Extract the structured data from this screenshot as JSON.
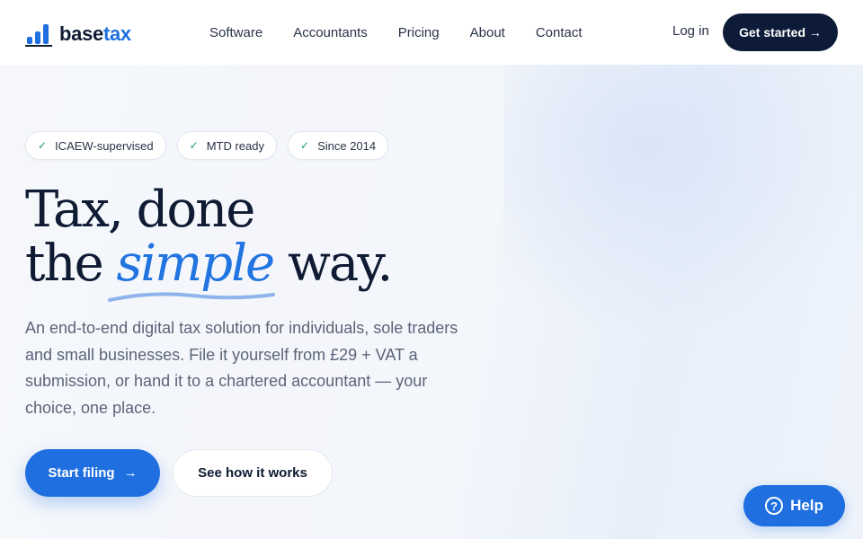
{
  "brand": {
    "name_part1": "base",
    "name_part2": "tax",
    "accent": "#1f6fe0",
    "dark": "#0d1b38"
  },
  "nav": {
    "items": [
      "Software",
      "Accountants",
      "Pricing",
      "About",
      "Contact"
    ]
  },
  "header": {
    "login": "Log in",
    "cta": "Get started →"
  },
  "badges": [
    {
      "icon": "check-icon",
      "label": "ICAEW-supervised"
    },
    {
      "icon": "check-icon",
      "label": "MTD ready"
    },
    {
      "icon": "check-icon",
      "label": "Since 2014"
    }
  ],
  "hero": {
    "headline_line1": "Tax, done",
    "headline_the": "the",
    "headline_accent": "simple",
    "headline_end": "way.",
    "subtext": "An end-to-end digital tax solution for individuals, sole traders and small businesses. File it yourself from £29 + VAT a submission, or hand it to a chartered accountant — your choice, one place.",
    "primary_cta": "Start filing",
    "primary_cta_icon": "arrow-right-icon",
    "secondary_cta": "See how it works"
  },
  "help_widget": {
    "label": "Help",
    "icon": "question-circle-icon"
  }
}
